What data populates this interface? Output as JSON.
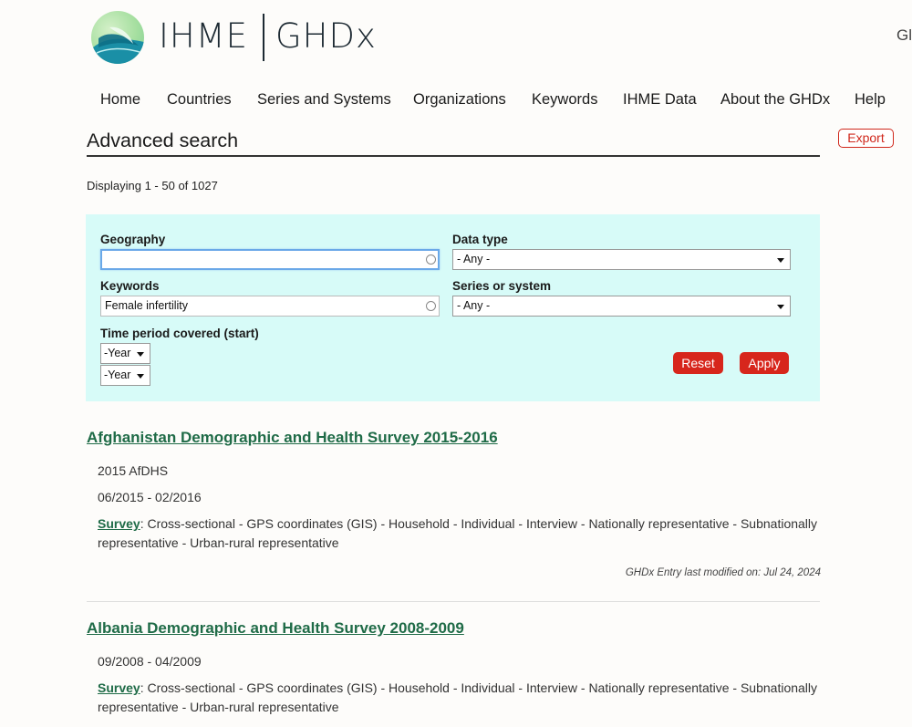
{
  "header": {
    "brand_left": "IHME",
    "brand_right": "GHDx",
    "right_text": "Gl"
  },
  "nav": {
    "items": [
      {
        "label": "Home"
      },
      {
        "label": "Countries"
      },
      {
        "label": "Series and Systems"
      },
      {
        "label": "Organizations"
      },
      {
        "label": "Keywords"
      },
      {
        "label": "IHME Data"
      },
      {
        "label": "About the GHDx"
      },
      {
        "label": "Help"
      }
    ]
  },
  "page": {
    "title": "Advanced search",
    "export_label": "Export",
    "display_count": "Displaying 1 - 50 of 1027"
  },
  "filters": {
    "geography": {
      "label": "Geography",
      "value": ""
    },
    "data_type": {
      "label": "Data type",
      "value": "- Any -"
    },
    "keywords": {
      "label": "Keywords",
      "value": "Female infertility"
    },
    "series": {
      "label": "Series or system",
      "value": "- Any -"
    },
    "time_period": {
      "label": "Time period covered (start)",
      "start_year": "-Year",
      "end_year": "-Year"
    },
    "reset_label": "Reset",
    "apply_label": "Apply"
  },
  "results": [
    {
      "title": "Afghanistan Demographic and Health Survey 2015-2016",
      "short_name": "2015 AfDHS",
      "dates": "06/2015 - 02/2016",
      "type_link": "Survey",
      "description": ": Cross-sectional - GPS coordinates (GIS) - Household - Individual - Interview - Nationally representative - Subnationally representative - Urban-rural representative",
      "modified": "GHDx Entry last modified on: Jul 24, 2024"
    },
    {
      "title": "Albania Demographic and Health Survey 2008-2009",
      "dates": "09/2008 - 04/2009",
      "type_link": "Survey",
      "description": ": Cross-sectional - GPS coordinates (GIS) - Household - Individual - Interview - Nationally representative - Subnationally representative - Urban-rural representative"
    }
  ]
}
